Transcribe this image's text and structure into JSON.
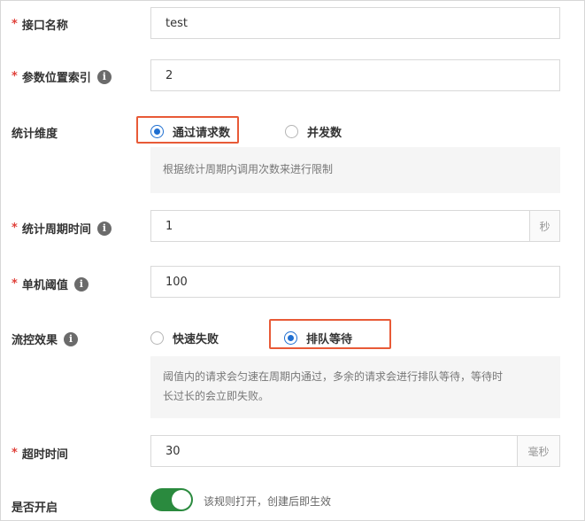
{
  "fields": {
    "interface_name": {
      "label": "接口名称",
      "required": "*",
      "value": "test"
    },
    "param_index": {
      "label": "参数位置索引",
      "required": "*",
      "value": "2"
    },
    "stat_dimension": {
      "label": "统计维度",
      "options": [
        {
          "label": "通过请求数",
          "checked": true
        },
        {
          "label": "并发数",
          "checked": false
        }
      ],
      "hint": "根据统计周期内调用次数来进行限制"
    },
    "stat_period": {
      "label": "统计周期时间",
      "required": "*",
      "value": "1",
      "unit": "秒"
    },
    "threshold": {
      "label": "单机阈值",
      "required": "*",
      "value": "100"
    },
    "flow_effect": {
      "label": "流控效果",
      "options": [
        {
          "label": "快速失败",
          "checked": false
        },
        {
          "label": "排队等待",
          "checked": true
        }
      ],
      "hint_line1": "阈值内的请求会匀速在周期内通过，多余的请求会进行排队等待，等待时",
      "hint_line2": "长过长的会立即失败。"
    },
    "timeout": {
      "label": "超时时间",
      "required": "*",
      "value": "30",
      "unit": "毫秒"
    },
    "enabled": {
      "label": "是否开启",
      "on": true,
      "desc": "该规则打开，创建后即生效"
    }
  },
  "icons": {
    "info": "info-icon",
    "info_glyph": "i"
  },
  "colors": {
    "accent": "#1f6fd1",
    "highlight": "#e85a37",
    "switch_on": "#2a8a3e",
    "required": "#e0413a"
  }
}
